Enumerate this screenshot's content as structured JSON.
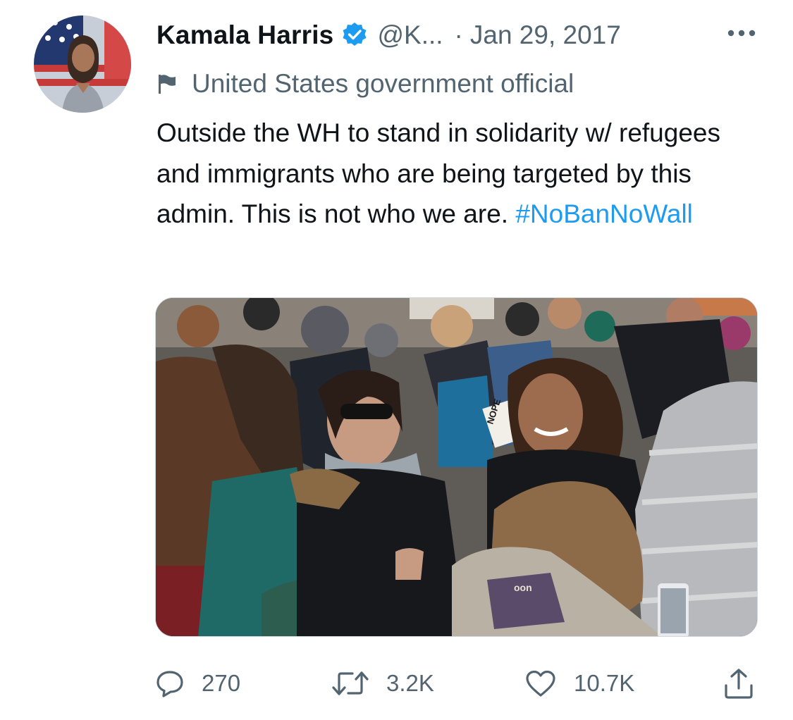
{
  "author": {
    "display_name": "Kamala Harris",
    "handle": "@K...",
    "separator": "·",
    "date": "Jan 29, 2017",
    "label": "United States government official"
  },
  "tweet": {
    "text": "Outside the WH to stand in solidarity w/ refugees and immigrants who are being targeted by this admin. This is not who we are. ",
    "hashtag": "#NoBanNoWall"
  },
  "media": {
    "visible_text": [
      "NOPE",
      "oon"
    ]
  },
  "actions": {
    "reply_count": "270",
    "retweet_count": "3.2K",
    "like_count": "10.7K"
  },
  "icons": {
    "verified": "verified-badge-icon",
    "more": "more-options-icon",
    "label": "flag-icon",
    "reply": "reply-icon",
    "retweet": "retweet-icon",
    "like": "heart-icon",
    "share": "share-icon"
  },
  "colors": {
    "accent": "#1d9bf0",
    "text": "#0f1419",
    "secondary_text": "#536471"
  }
}
